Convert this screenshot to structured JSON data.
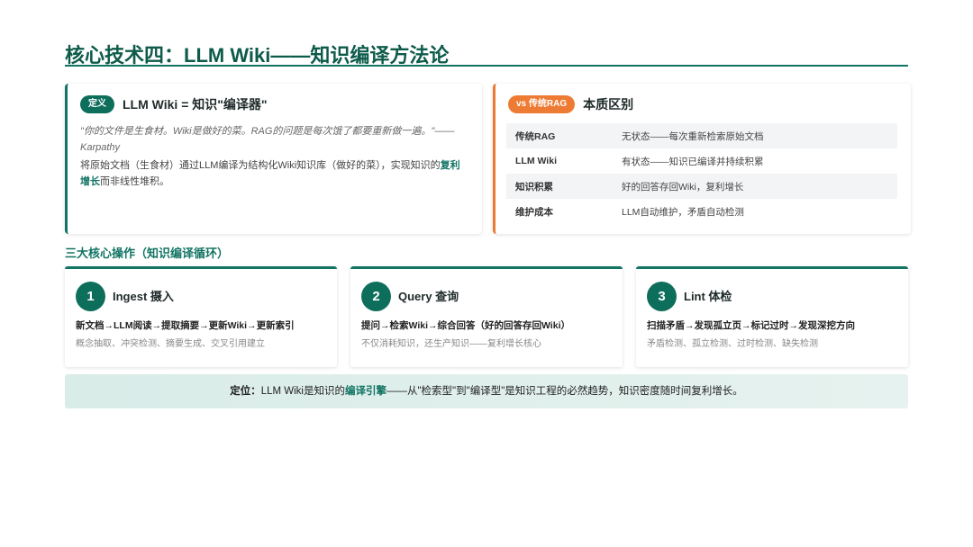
{
  "title": "核心技术四：LLM Wiki——知识编译方法论",
  "definition": {
    "badge": "定义",
    "heading": "LLM Wiki = 知识\"编译器\"",
    "quote": "\"你的文件是生食材。Wiki是做好的菜。RAG的问题是每次饿了都要重新做一遍。\"——Karpathy",
    "desc_pre": "将原始文档（生食材）通过LLM编译为结构化Wiki知识库（做好的菜），实现知识的",
    "desc_bold": "复利增长",
    "desc_post": "而非线性堆积。"
  },
  "compare": {
    "badge": "vs 传统RAG",
    "heading": "本质区别",
    "rows": [
      {
        "key": "传统RAG",
        "value": "无状态——每次重新检索原始文档"
      },
      {
        "key": "LLM Wiki",
        "value": "有状态——知识已编译并持续积累"
      },
      {
        "key": "知识积累",
        "value": "好的回答存回Wiki，复利增长"
      },
      {
        "key": "维护成本",
        "value": "LLM自动维护，矛盾自动检测"
      }
    ]
  },
  "section_title": "三大核心操作（知识编译循环）",
  "operations": [
    {
      "num": "1",
      "name": "Ingest 摄入",
      "flow": "新文档→LLM阅读→提取摘要→更新Wiki→更新索引",
      "sub": "概念抽取、冲突检测、摘要生成、交叉引用建立"
    },
    {
      "num": "2",
      "name": "Query 查询",
      "flow": "提问→检索Wiki→综合回答（好的回答存回Wiki）",
      "sub": "不仅消耗知识，还生产知识——复利增长核心"
    },
    {
      "num": "3",
      "name": "Lint 体检",
      "flow": "扫描矛盾→发现孤立页→标记过时→发现深挖方向",
      "sub": "矛盾检测、孤立检测、过时检测、缺失检测"
    }
  ],
  "footer": {
    "label": "定位：",
    "pre": "LLM Wiki是知识的",
    "bold": "编译引擎",
    "post": "——从\"检索型\"到\"编译型\"是知识工程的必然趋势，知识密度随时间复利增长。"
  },
  "colors": {
    "primary": "#127463",
    "accent": "#ee7b34"
  }
}
